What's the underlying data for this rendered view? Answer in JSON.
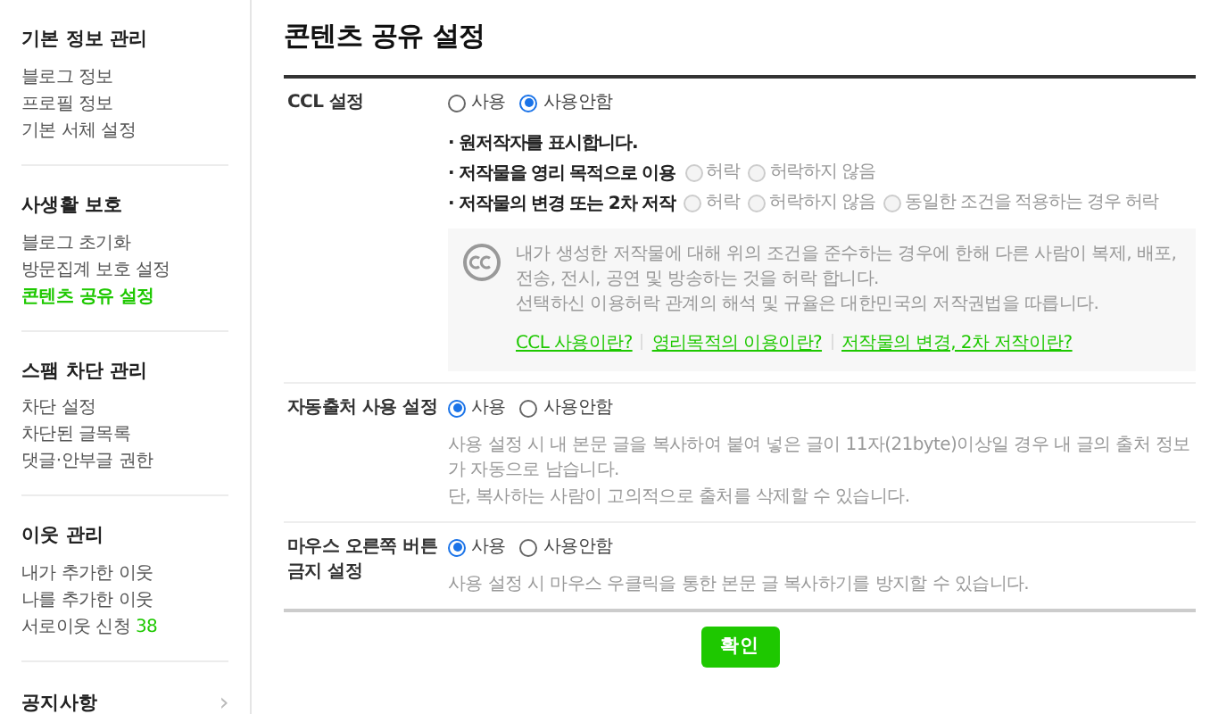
{
  "sidebar": {
    "sections": [
      {
        "title": "기본 정보 관리",
        "items": [
          {
            "label": "블로그 정보",
            "selected": false
          },
          {
            "label": "프로필 정보",
            "selected": false
          },
          {
            "label": "기본 서체 설정",
            "selected": false
          }
        ]
      },
      {
        "title": "사생활 보호",
        "items": [
          {
            "label": "블로그 초기화",
            "selected": false
          },
          {
            "label": "방문집계 보호 설정",
            "selected": false
          },
          {
            "label": "콘텐츠 공유 설정",
            "selected": true
          }
        ]
      },
      {
        "title": "스팸 차단 관리",
        "items": [
          {
            "label": "차단 설정",
            "selected": false
          },
          {
            "label": "차단된 글목록",
            "selected": false
          },
          {
            "label": "댓글·안부글 권한",
            "selected": false
          }
        ]
      },
      {
        "title": "이웃 관리",
        "items": [
          {
            "label": "내가 추가한 이웃",
            "selected": false
          },
          {
            "label": "나를 추가한 이웃",
            "selected": false
          },
          {
            "label": "서로이웃 신청",
            "selected": false,
            "count": "38"
          }
        ]
      }
    ],
    "notice": {
      "label": "공지사항",
      "arrow": "›"
    }
  },
  "page_title": "콘텐츠 공유 설정",
  "settings": [
    {
      "kind": "ccl",
      "label": "CCL 설정",
      "options": [
        {
          "label": "사용",
          "selected": false
        },
        {
          "label": "사용안함",
          "selected": true
        }
      ],
      "conditions": [
        {
          "label": "· 원저작자를 표시합니다."
        },
        {
          "label": "· 저작물을 영리 목적으로 이용",
          "options": [
            {
              "label": "허락",
              "selected": false,
              "disabled": true
            },
            {
              "label": "허락하지 않음",
              "selected": false,
              "disabled": true
            }
          ]
        },
        {
          "label": "· 저작물의 변경 또는 2차 저작",
          "options": [
            {
              "label": "허락",
              "selected": false,
              "disabled": true
            },
            {
              "label": "허락하지 않음",
              "selected": false,
              "disabled": true
            },
            {
              "label": "동일한 조건을 적용하는 경우 허락",
              "selected": false,
              "disabled": true
            }
          ]
        }
      ],
      "info": {
        "lines": [
          "내가 생성한 저작물에 대해 위의 조건을 준수하는 경우에 한해 다른 사람이 복제, 배포, 전송, 전시, 공연 및 방송하는 것을 허락 합니다.",
          "선택하신 이용허락 관계의 해석 및 규율은 대한민국의 저작권법을 따릅니다."
        ],
        "links": [
          "CCL 사용이란?",
          "영리목적의 이용이란?",
          "저작물의 변경, 2차 저작이란?"
        ]
      }
    },
    {
      "kind": "plain",
      "label": "자동출처 사용 설정",
      "options": [
        {
          "label": "사용",
          "selected": true
        },
        {
          "label": "사용안함",
          "selected": false
        }
      ],
      "description": [
        "사용 설정 시 내 본문 글을 복사하여 붙여 넣은 글이 11자(21byte)이상일 경우 내 글의 출처 정보가 자동으로 남습니다.",
        "단, 복사하는 사람이 고의적으로 출처를 삭제할 수 있습니다."
      ]
    },
    {
      "kind": "plain",
      "label": "마우스 오른쪽 버튼 금지 설정",
      "options": [
        {
          "label": "사용",
          "selected": true
        },
        {
          "label": "사용안함",
          "selected": false
        }
      ],
      "description": [
        "사용 설정 시 마우스 우클릭을 통한 본문 글 복사하기를 방지할 수 있습니다."
      ]
    }
  ],
  "confirm_button": "확인"
}
